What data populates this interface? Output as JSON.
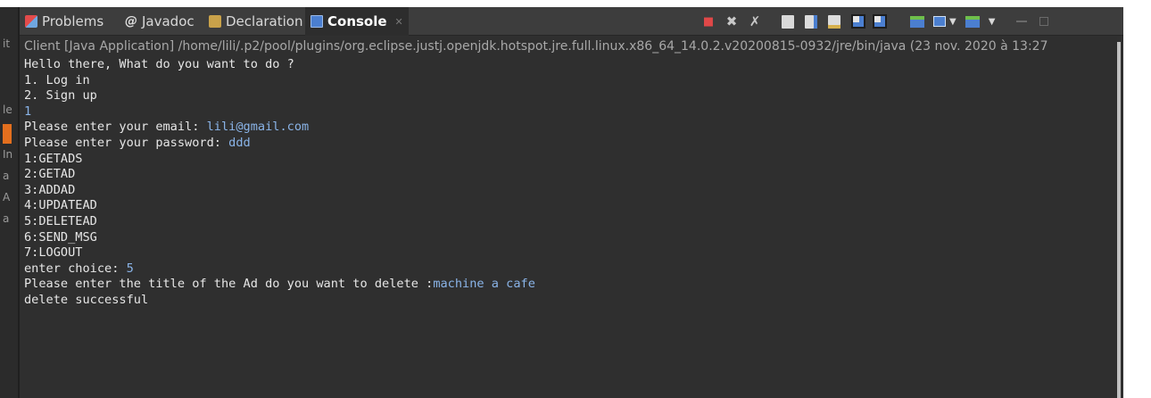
{
  "left_strip": {
    "fragments": [
      "it",
      "le",
      "In",
      "a",
      "A",
      "a"
    ]
  },
  "tabs": [
    {
      "label": "Problems",
      "icon": "problems-icon",
      "active": false
    },
    {
      "label": "Javadoc",
      "icon": "javadoc-icon",
      "active": false
    },
    {
      "label": "Declaration",
      "icon": "declaration-icon",
      "active": false
    },
    {
      "label": "Console",
      "icon": "console-icon",
      "active": true
    }
  ],
  "console": {
    "header": "Client [Java Application] /home/lili/.p2/pool/plugins/org.eclipse.justj.openjdk.hotspot.jre.full.linux.x86_64_14.0.2.v20200815-0932/jre/bin/java  (23 nov. 2020 à 13:27",
    "lines": [
      {
        "out": "Hello there, What do you want to do ?",
        "in": ""
      },
      {
        "out": "1. Log in",
        "in": ""
      },
      {
        "out": "2. Sign up",
        "in": ""
      },
      {
        "out": "",
        "in": "1"
      },
      {
        "out": "Please enter your email: ",
        "in": "lili@gmail.com"
      },
      {
        "out": "Please enter your password: ",
        "in": "ddd"
      },
      {
        "out": "1:GETADS",
        "in": ""
      },
      {
        "out": "2:GETAD",
        "in": ""
      },
      {
        "out": "3:ADDAD",
        "in": ""
      },
      {
        "out": "4:UPDATEAD",
        "in": ""
      },
      {
        "out": "5:DELETEAD",
        "in": ""
      },
      {
        "out": "6:SEND_MSG",
        "in": ""
      },
      {
        "out": "7:LOGOUT",
        "in": ""
      },
      {
        "out": "enter choice: ",
        "in": "5"
      },
      {
        "out": "Please enter the title of the Ad do you want to delete :",
        "in": "machine a cafe"
      },
      {
        "out": "delete successful",
        "in": ""
      }
    ]
  },
  "colors": {
    "background": "#2f2f2f",
    "output_text": "#e6e6e6",
    "input_text": "#8ab4e8"
  }
}
